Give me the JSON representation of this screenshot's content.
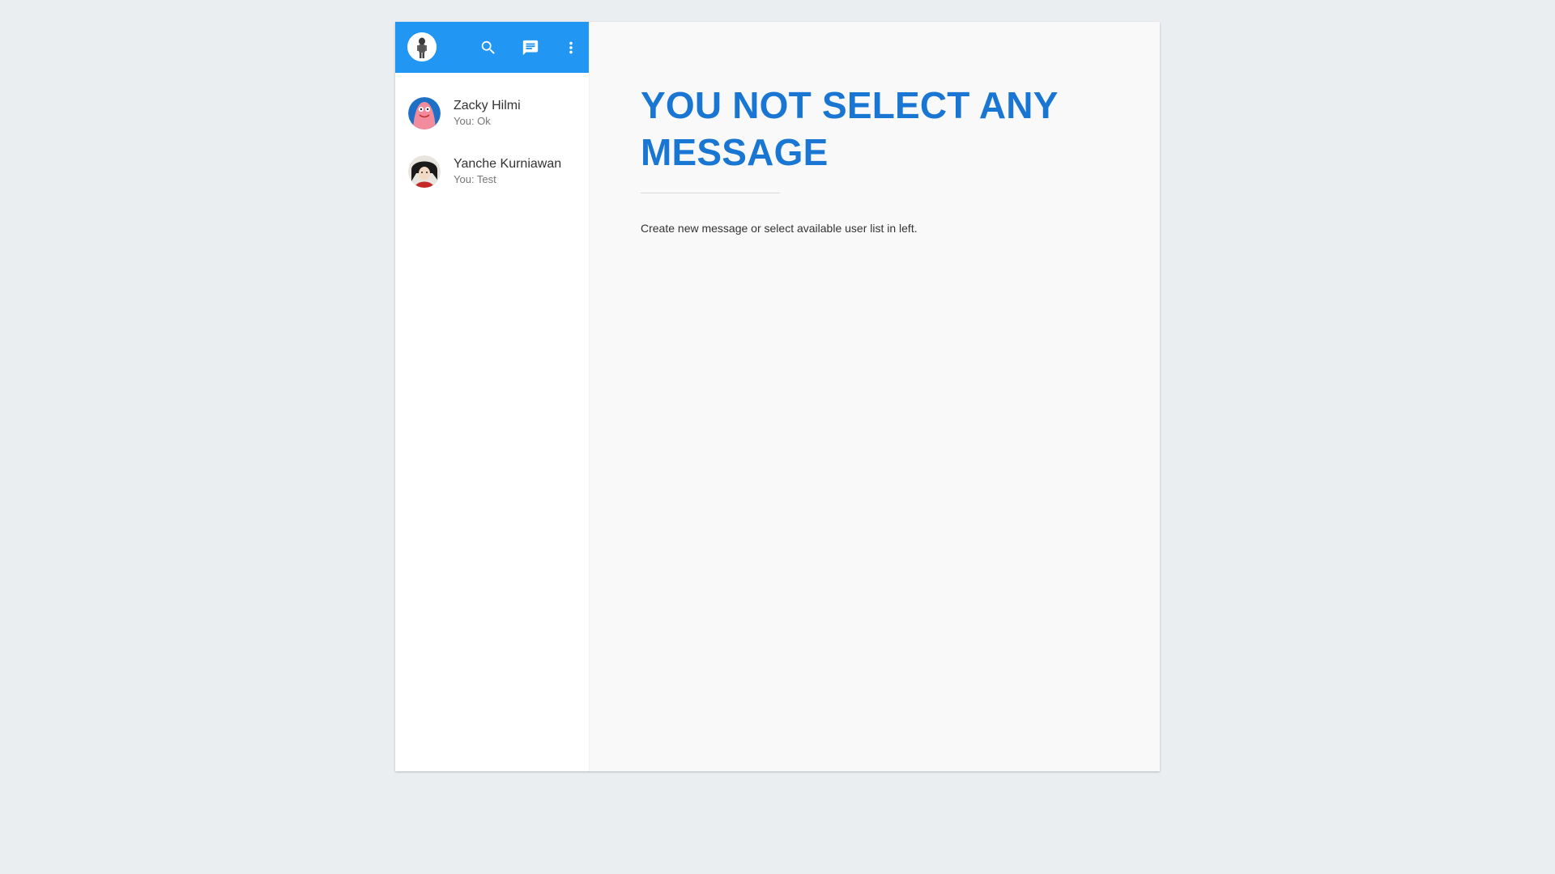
{
  "header": {
    "my_avatar_icon": "user-avatar-icon",
    "actions": [
      {
        "icon": "search-icon",
        "label": "search"
      },
      {
        "icon": "chat-icon",
        "label": "new message"
      },
      {
        "icon": "more-vert-icon",
        "label": "menu"
      }
    ]
  },
  "contacts": [
    {
      "name": "Zacky Hilmi",
      "last_message": "You: Ok",
      "avatar_icon": "patrick-avatar-icon"
    },
    {
      "name": "Yanche Kurniawan",
      "last_message": "You: Test",
      "avatar_icon": "anime-avatar-icon"
    }
  ],
  "main": {
    "title": "YOU NOT SELECT ANY MESSAGE",
    "description": "Create new message or select available user list in left."
  },
  "colors": {
    "primary": "#2196f3",
    "title": "#1976d2",
    "background": "#ebeef1"
  }
}
